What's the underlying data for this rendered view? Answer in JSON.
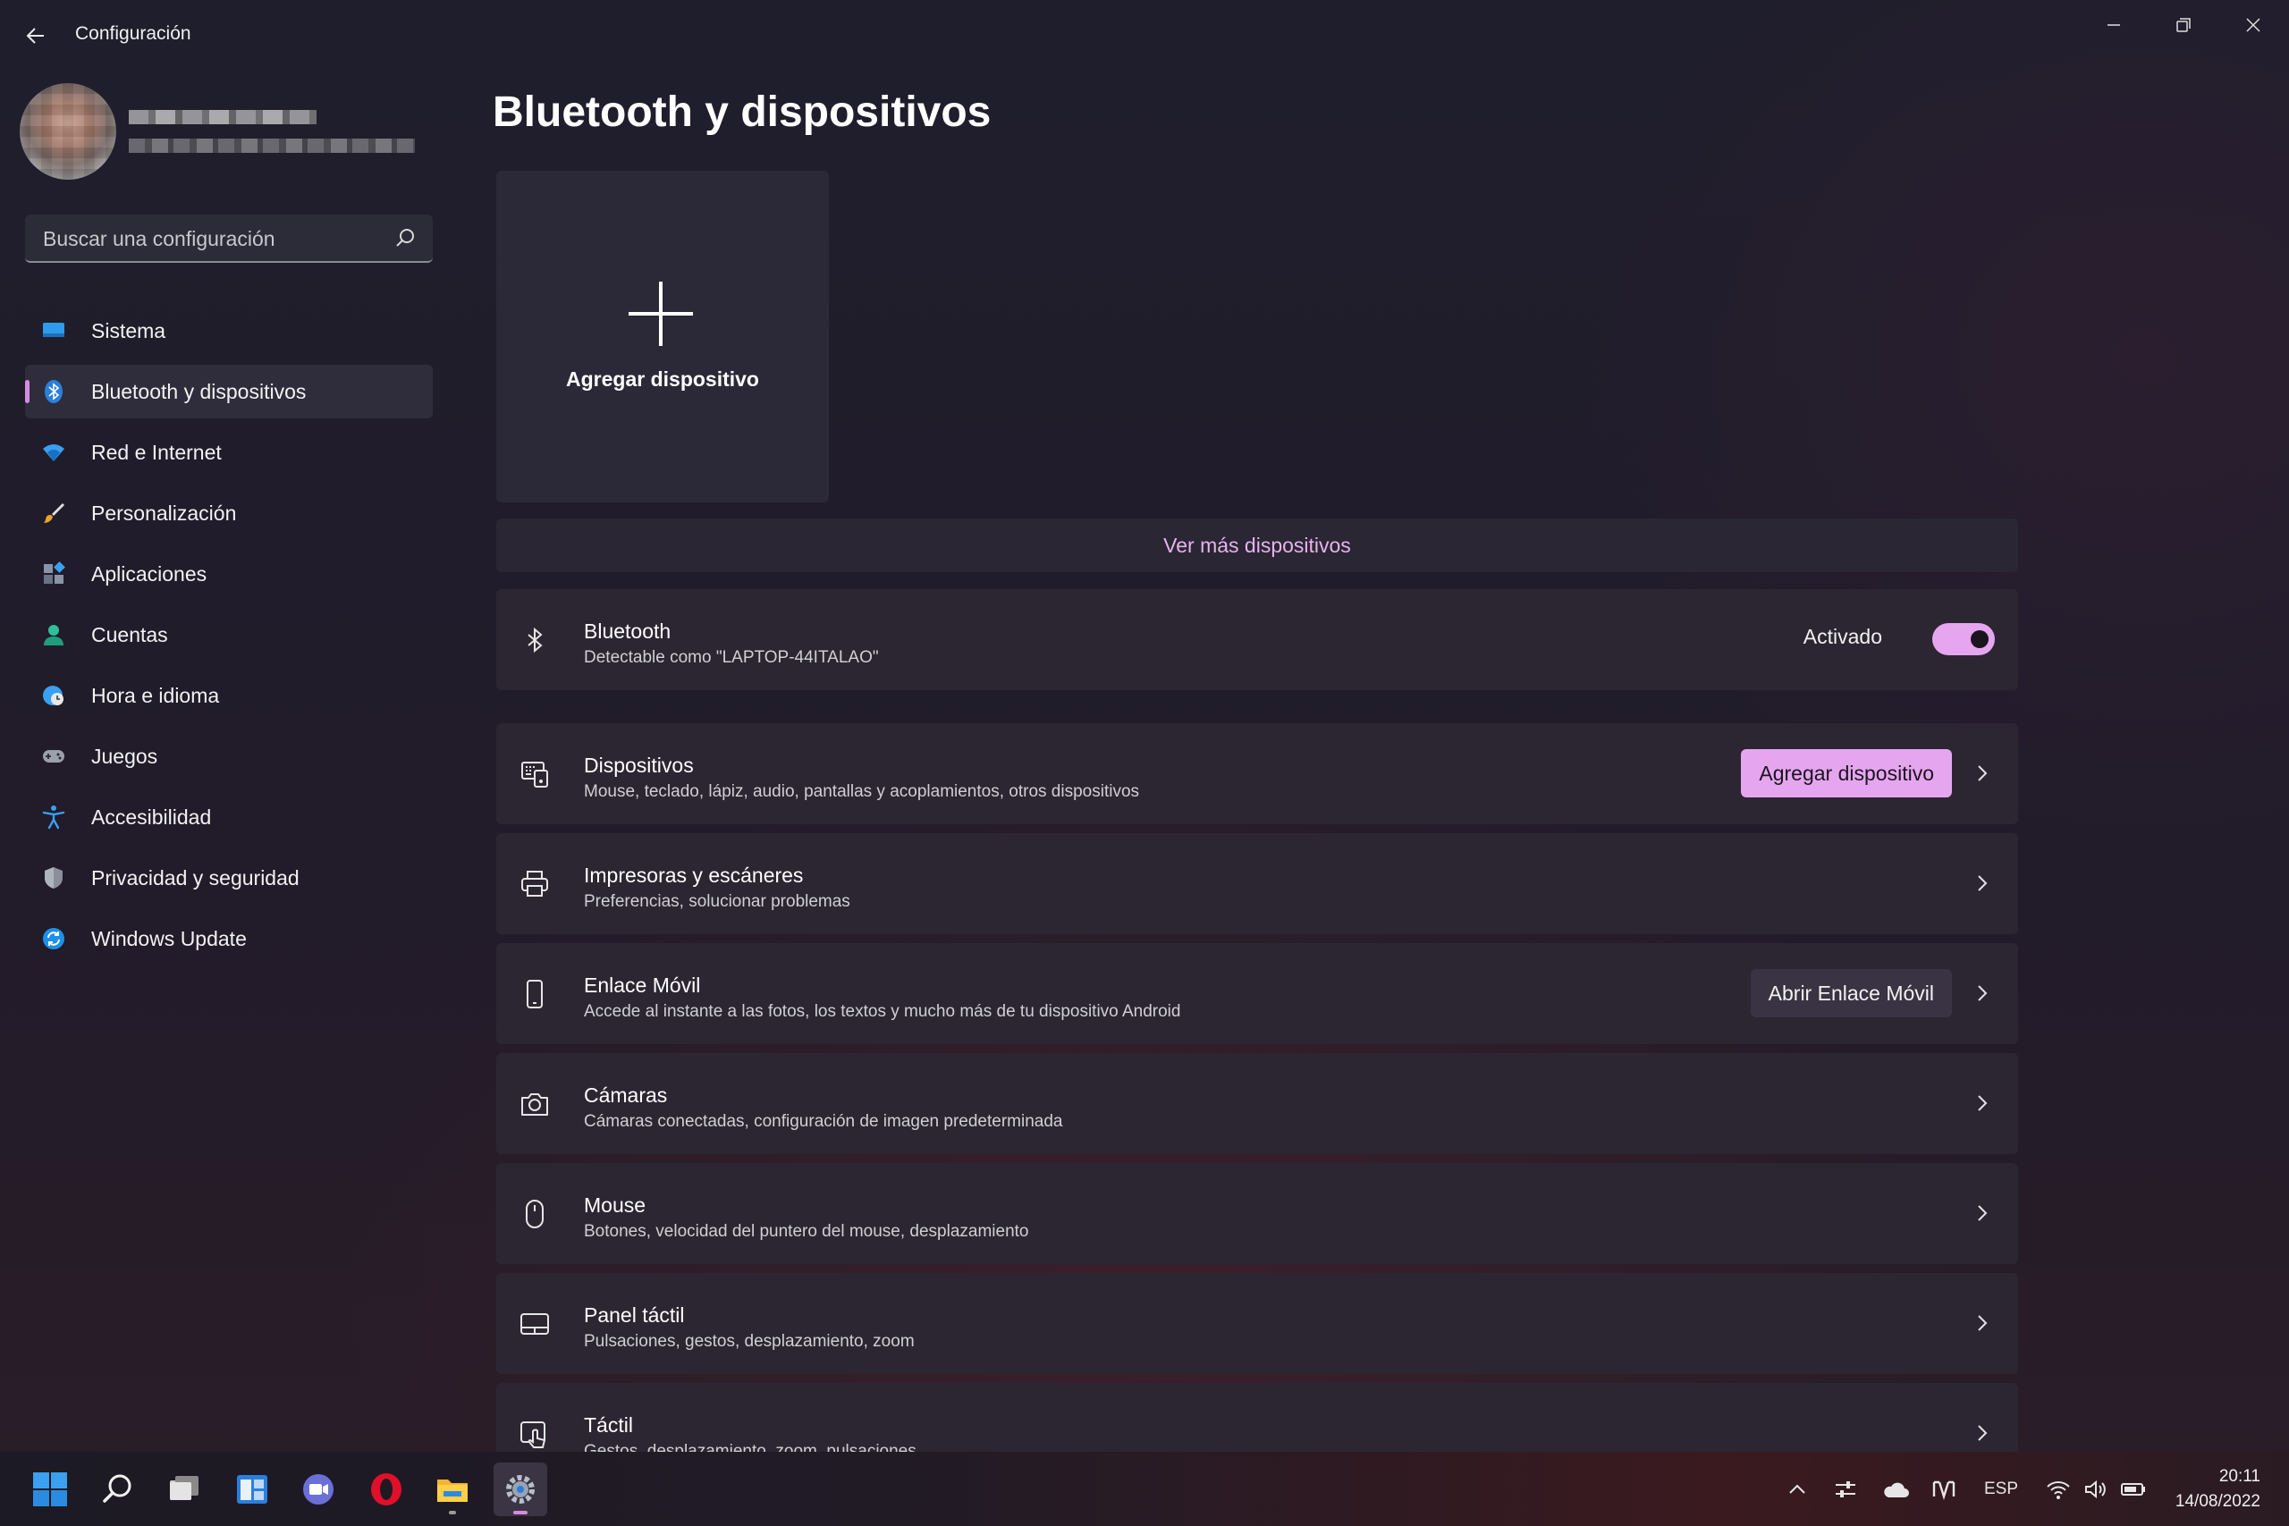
{
  "window": {
    "title": "Configuración"
  },
  "sidebar": {
    "search_placeholder": "Buscar una configuración",
    "items": [
      {
        "label": "Sistema",
        "icon": "system-icon"
      },
      {
        "label": "Bluetooth y dispositivos",
        "icon": "bluetooth-icon",
        "active": true
      },
      {
        "label": "Red e Internet",
        "icon": "wifi-icon"
      },
      {
        "label": "Personalización",
        "icon": "brush-icon"
      },
      {
        "label": "Aplicaciones",
        "icon": "apps-icon"
      },
      {
        "label": "Cuentas",
        "icon": "account-icon"
      },
      {
        "label": "Hora e idioma",
        "icon": "globe-clock-icon"
      },
      {
        "label": "Juegos",
        "icon": "gamepad-icon"
      },
      {
        "label": "Accesibilidad",
        "icon": "accessibility-icon"
      },
      {
        "label": "Privacidad y seguridad",
        "icon": "shield-icon"
      },
      {
        "label": "Windows Update",
        "icon": "update-icon"
      }
    ]
  },
  "main": {
    "title": "Bluetooth y dispositivos",
    "add_card_label": "Agregar dispositivo",
    "more_devices": "Ver más dispositivos",
    "bluetooth": {
      "title": "Bluetooth",
      "subtitle": "Detectable como \"LAPTOP-44ITALAO\"",
      "state_label": "Activado",
      "enabled": true
    },
    "rows": [
      {
        "title": "Dispositivos",
        "subtitle": "Mouse, teclado, lápiz, audio, pantallas y acoplamientos, otros dispositivos",
        "button": "Agregar dispositivo",
        "icon": "devices-icon"
      },
      {
        "title": "Impresoras y escáneres",
        "subtitle": "Preferencias, solucionar problemas",
        "icon": "printer-icon"
      },
      {
        "title": "Enlace Móvil",
        "subtitle": "Accede al instante a las fotos, los textos y mucho más de tu dispositivo Android",
        "button": "Abrir Enlace Móvil",
        "icon": "phone-icon"
      },
      {
        "title": "Cámaras",
        "subtitle": "Cámaras conectadas, configuración de imagen predeterminada",
        "icon": "camera-icon"
      },
      {
        "title": "Mouse",
        "subtitle": "Botones, velocidad del puntero del mouse, desplazamiento",
        "icon": "mouse-icon"
      },
      {
        "title": "Panel táctil",
        "subtitle": "Pulsaciones, gestos, desplazamiento, zoom",
        "icon": "touchpad-icon"
      },
      {
        "title": "Táctil",
        "subtitle": "Gestos, desplazamiento, zoom, pulsaciones",
        "icon": "touch-icon"
      }
    ]
  },
  "taskbar": {
    "language": "ESP",
    "time": "20:11",
    "date": "14/08/2022"
  },
  "colors": {
    "accent": "#e5a6ef",
    "nav_indicator": "#d68be0",
    "card_background": "#2c2633"
  }
}
